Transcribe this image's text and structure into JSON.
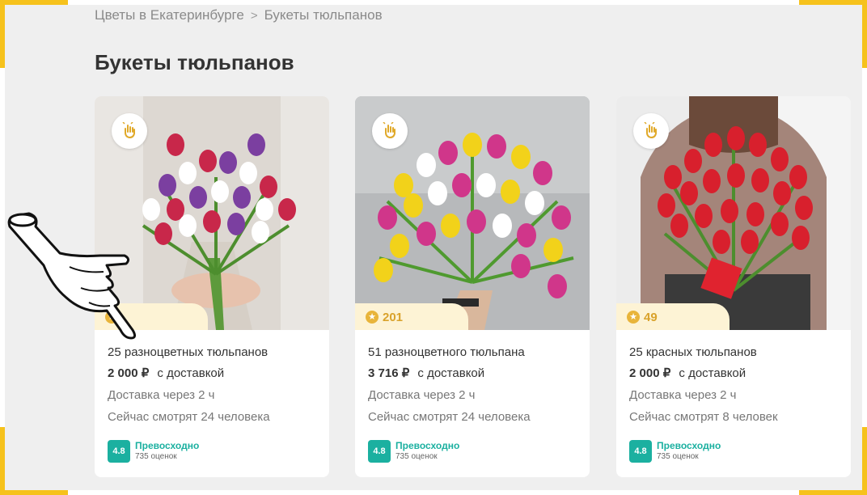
{
  "breadcrumb": {
    "parent": "Цветы в Екатеринбурге",
    "separator": ">",
    "current": "Букеты тюльпанов"
  },
  "page_title": "Букеты тюльпанов",
  "colors": {
    "accent": "#f6c21c",
    "teal": "#1bb0a0",
    "rating_gold": "#d9a22b"
  },
  "cards": [
    {
      "image": "mixed-tulip-bouquet-photo",
      "rating_count": "",
      "name": "25 разноцветных тюльпанов",
      "price": "2 000 ₽",
      "price_suffix": "с доставкой",
      "delivery": "Доставка через 2 ч",
      "viewers": "Сейчас смотрят 24 человека",
      "score": "4.8",
      "score_label": "Превосходно",
      "reviews": "735 оценок"
    },
    {
      "image": "colorful-tulip-bouquet-photo",
      "rating_count": "201",
      "name": "51 разноцветного тюльпана",
      "price": "3 716 ₽",
      "price_suffix": "с доставкой",
      "delivery": "Доставка через 2 ч",
      "viewers": "Сейчас смотрят 24 человека",
      "score": "4.8",
      "score_label": "Превосходно",
      "reviews": "735 оценок"
    },
    {
      "image": "red-tulip-bouquet-photo",
      "rating_count": "49",
      "name": "25 красных тюльпанов",
      "price": "2 000 ₽",
      "price_suffix": "с доставкой",
      "delivery": "Доставка через 2 ч",
      "viewers": "Сейчас смотрят 8 человек",
      "score": "4.8",
      "score_label": "Превосходно",
      "reviews": "735 оценок"
    }
  ]
}
